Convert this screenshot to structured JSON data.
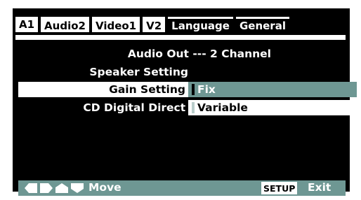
{
  "tabs": [
    "A1",
    "Audio2",
    "Video1",
    "V2",
    "Language",
    "General"
  ],
  "active_tab": "Audio2",
  "menu": {
    "audio_out": "Audio Out --- 2 Channel",
    "speaker_setting": "Speaker Setting",
    "gain_setting": "Gain Setting",
    "cd_digital_direct": "CD Digital Direct -"
  },
  "options": {
    "fix": "Fix",
    "variable": "Variable",
    "selected": "Fix"
  },
  "bottom_bar": {
    "move_label": "Move",
    "setup_label": "SETUP",
    "exit_label": "Exit",
    "nav_icons": [
      "arrow-left-icon",
      "arrow-right-icon",
      "arrow-up-icon",
      "arrow-down-icon"
    ]
  },
  "colors": {
    "background": "#000000",
    "accent": "#6e9793",
    "text": "#ffffff",
    "highlight": "#ffffff"
  }
}
